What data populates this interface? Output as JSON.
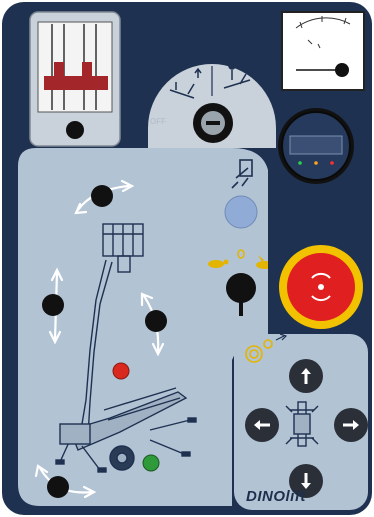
{
  "colors": {
    "panel_navy": "#1e3150",
    "plate_blue": "#b2c3d4",
    "plate_light": "#c9d2db",
    "knob_black": "#111111",
    "indicator_red": "#d9281e",
    "indicator_green": "#2f9a3a",
    "button_blue": "#8fabd6",
    "estop_yellow": "#f2c200",
    "estop_red": "#e02020"
  },
  "key_switch": {
    "off_label": "OFF",
    "knob_icon": "minus-icon"
  },
  "brand": {
    "name": "DINOlift"
  },
  "icons": {
    "mode_left": "platform-control-icon",
    "mode_right": "ground-control-icon",
    "speed_slow": "turtle-icon",
    "speed_fast": "hare-icon",
    "outrigger_select": "outrigger-icon",
    "drive": "track-drive-icon"
  },
  "arrow_buttons": [
    "arrow-up-icon",
    "arrow-left-icon",
    "arrow-right-icon",
    "arrow-down-icon"
  ]
}
